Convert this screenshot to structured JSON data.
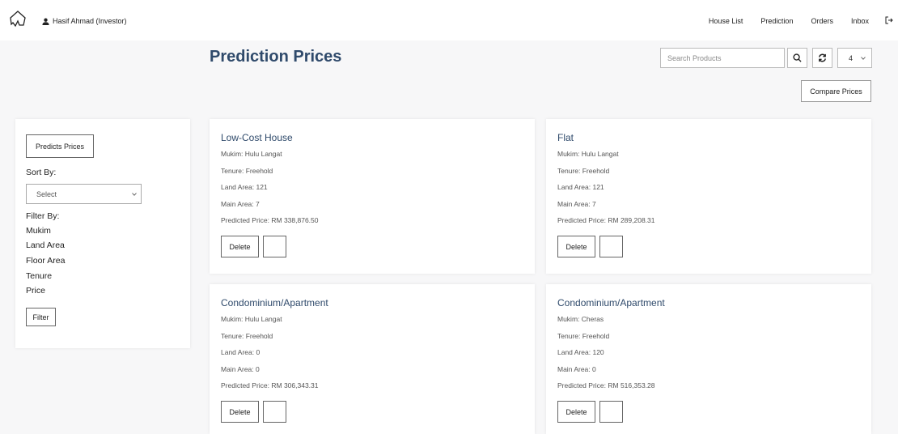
{
  "navbar": {
    "user_label": "Hasif Ahmad (Investor)",
    "links": [
      "House List",
      "Prediction",
      "Orders",
      "Inbox"
    ]
  },
  "page": {
    "title": "Prediction Prices"
  },
  "toolbar": {
    "search_placeholder": "Search Products",
    "page_size": "4",
    "compare_label": "Compare Prices"
  },
  "sidebar": {
    "predicts_label": "Predicts Prices",
    "sort_label": "Sort By:",
    "sort_select_value": "Select",
    "filter_label": "Filter By:",
    "filter_options": [
      "Mukim",
      "Land Area",
      "Floor Area",
      "Tenure",
      "Price"
    ],
    "filter_button": "Filter"
  },
  "cards": [
    {
      "title": "Low-Cost House",
      "mukim": "Mukim: Hulu Langat",
      "tenure": "Tenure: Freehold",
      "land_area": "Land Area: 121",
      "main_area": "Main Area: 7",
      "price": "Predicted Price: RM 338,876.50",
      "delete_label": "Delete"
    },
    {
      "title": "Flat",
      "mukim": "Mukim: Hulu Langat",
      "tenure": "Tenure: Freehold",
      "land_area": "Land Area: 121",
      "main_area": "Main Area: 7",
      "price": "Predicted Price: RM 289,208.31",
      "delete_label": "Delete"
    },
    {
      "title": "Condominium/Apartment",
      "mukim": "Mukim: Hulu Langat",
      "tenure": "Tenure: Freehold",
      "land_area": "Land Area: 0",
      "main_area": "Main Area: 0",
      "price": "Predicted Price: RM 306,343.31",
      "delete_label": "Delete"
    },
    {
      "title": "Condominium/Apartment",
      "mukim": "Mukim: Cheras",
      "tenure": "Tenure: Freehold",
      "land_area": "Land Area: 120",
      "main_area": "Main Area: 0",
      "price": "Predicted Price: RM 516,353.28",
      "delete_label": "Delete"
    }
  ],
  "icons": {
    "logo": "house-logo-icon",
    "user": "user-icon",
    "logout": "logout-icon",
    "search": "search-icon",
    "refresh": "refresh-icon",
    "dropdown": "chevron-down-icon"
  },
  "colors": {
    "title": "#2f4a6b",
    "background": "#f7f7f8"
  }
}
